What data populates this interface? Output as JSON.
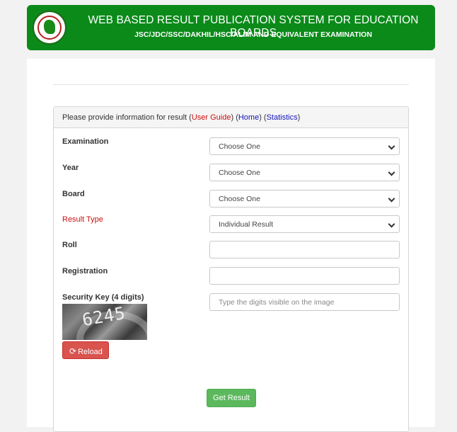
{
  "header": {
    "title": "WEB BASED RESULT PUBLICATION SYSTEM FOR EDUCATION BOARDS",
    "subtitle": "JSC/JDC/SSC/DAKHIL/HSC/ALIM AND EQUIVALENT EXAMINATION"
  },
  "panel": {
    "intro": "Please provide information for result ",
    "user_guide": "User Guide",
    "home": "Home",
    "statistics": "Statistics",
    "lparen1": "(",
    "rparen1": ") (",
    "rparen2": ") (",
    "rparen3": ")"
  },
  "form": {
    "examination": {
      "label": "Examination",
      "value": "Choose One"
    },
    "year": {
      "label": "Year",
      "value": "Choose One"
    },
    "board": {
      "label": "Board",
      "value": "Choose One"
    },
    "result_type": {
      "label": "Result Type",
      "value": "Individual Result"
    },
    "roll": {
      "label": "Roll",
      "value": ""
    },
    "registration": {
      "label": "Registration",
      "value": ""
    },
    "security_key": {
      "label": "Security Key (4 digits)",
      "placeholder": "Type the digits visible on the image"
    },
    "captcha_text": "6245",
    "reload_label": "Reload",
    "submit_label": "Get Result"
  },
  "colors": {
    "header_bg": "#0b8a1a",
    "reload_bg": "#d9534f",
    "submit_bg": "#5cb85c",
    "link_red": "#cc1010",
    "link_blue": "#1414b8"
  },
  "icons": {
    "logo": "government-seal-icon",
    "reload": "refresh-icon",
    "select": "chevron-down-icon"
  }
}
